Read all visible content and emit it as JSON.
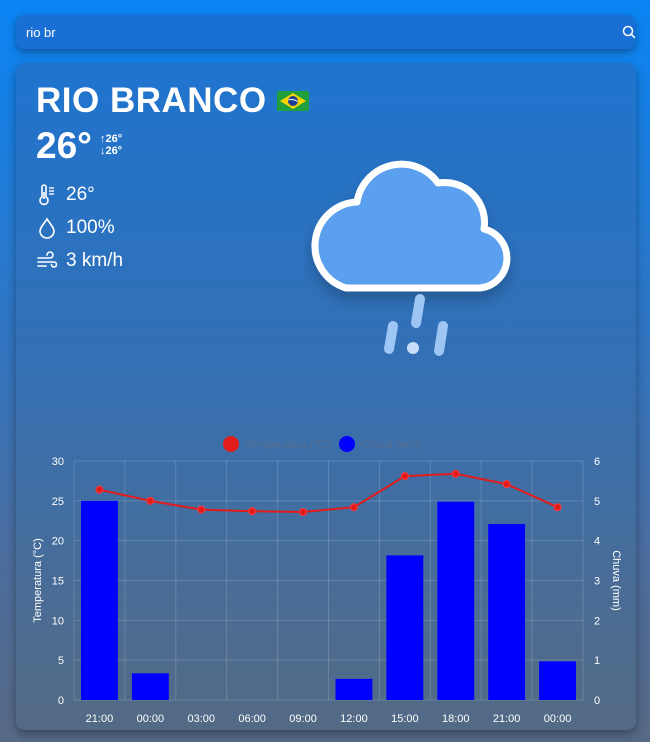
{
  "search": {
    "value": "rio br",
    "icon": "search-icon"
  },
  "current": {
    "city": "RIO BRANCO",
    "flag": "brazil-flag",
    "temperature": "26°",
    "max": "↑26°",
    "min": "↓26°",
    "feels_like": "26°",
    "humidity": "100%",
    "wind": "3 km/h",
    "condition_icon": "rain-cloud-icon"
  },
  "chart_data": {
    "type": "bar",
    "categories": [
      "21:00",
      "00:00",
      "03:00",
      "06:00",
      "09:00",
      "12:00",
      "15:00",
      "18:00",
      "21:00",
      "00:00"
    ],
    "series": [
      {
        "name": "Temperatura (°C)",
        "type": "line",
        "axis": "left",
        "color": "#e21b1b",
        "values": [
          26.4,
          25.0,
          23.9,
          23.7,
          23.6,
          24.2,
          28.1,
          28.4,
          27.1,
          24.2
        ]
      },
      {
        "name": "Chuva (mm)",
        "type": "bar",
        "axis": "right",
        "color": "#0000ff",
        "values": [
          5.0,
          0.67,
          0,
          0,
          0,
          0.53,
          3.63,
          4.98,
          4.42,
          0.97
        ]
      }
    ],
    "ylabel": "Temperatura (°C)",
    "y2label": "Chuva (mm)",
    "ylim": [
      0,
      30
    ],
    "y2lim": [
      0,
      6
    ],
    "yticks": [
      "0",
      "5",
      "10",
      "15",
      "20",
      "25",
      "30"
    ],
    "y2ticks": [
      "0",
      "1",
      "2",
      "3",
      "4",
      "5",
      "6"
    ],
    "grid": true,
    "legend": "top-center"
  }
}
